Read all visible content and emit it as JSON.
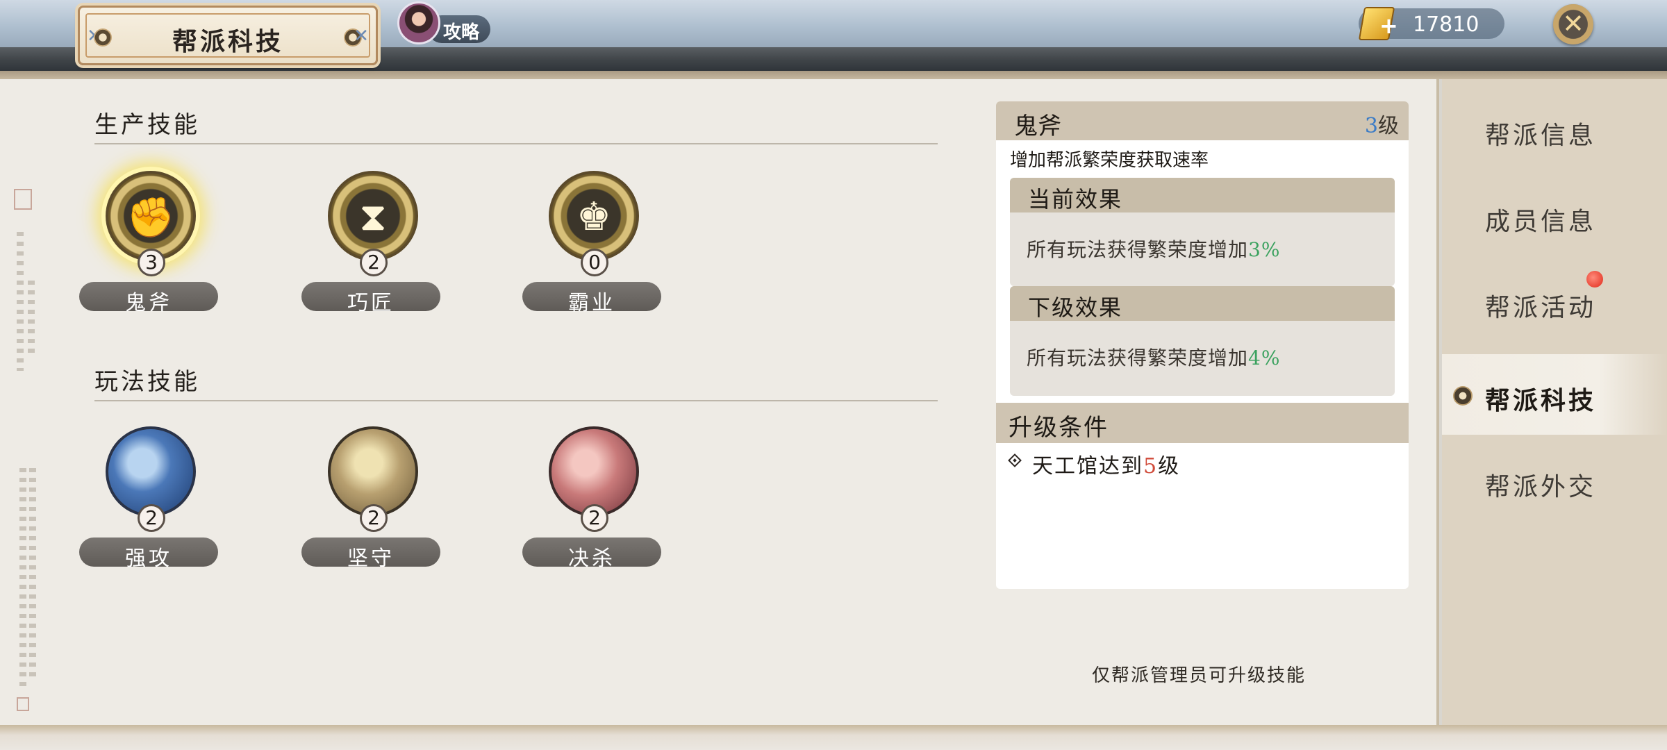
{
  "header": {
    "title": "帮派科技",
    "guide_label": "攻略",
    "currency_amount": "17810",
    "currency_plus": "+",
    "close_glyph": "✕"
  },
  "sections": {
    "production_title": "生产技能",
    "gameplay_title": "玩法技能"
  },
  "production_skills": [
    {
      "name": "鬼斧",
      "level": "3",
      "icon": "handshake-icon",
      "glyph": "✊"
    },
    {
      "name": "巧匠",
      "level": "2",
      "icon": "hourglass-icon",
      "glyph": "⧗"
    },
    {
      "name": "霸业",
      "level": "0",
      "icon": "group-icon",
      "glyph": "♚"
    }
  ],
  "gameplay_skills": [
    {
      "name": "强攻",
      "level": "2",
      "icon": "swordsman-icon"
    },
    {
      "name": "坚守",
      "level": "2",
      "icon": "guardian-icon"
    },
    {
      "name": "决杀",
      "level": "2",
      "icon": "warrior-icon"
    }
  ],
  "detail": {
    "name": "鬼斧",
    "level_num": "3",
    "level_unit": "级",
    "description": "增加帮派繁荣度获取速率",
    "current_title": "当前效果",
    "current_text": "所有玩法获得繁荣度增加",
    "current_value": "3%",
    "next_title": "下级效果",
    "next_text": "所有玩法获得繁荣度增加",
    "next_value": "4%",
    "upgrade_title": "升级条件",
    "upgrade_prefix": "天工馆达到",
    "upgrade_value": "5",
    "upgrade_suffix": "级"
  },
  "admin_note": "仅帮派管理员可升级技能",
  "nav": {
    "items": [
      {
        "label": "帮派信息",
        "active": false
      },
      {
        "label": "成员信息",
        "active": false
      },
      {
        "label": "帮派活动",
        "active": false,
        "notification": true
      },
      {
        "label": "帮派科技",
        "active": true
      },
      {
        "label": "帮派外交",
        "active": false
      }
    ]
  },
  "colors": {
    "accent_blue": "#3a7bc6",
    "effect_green": "#3aa15e",
    "requirement_red": "#d04b3a"
  }
}
